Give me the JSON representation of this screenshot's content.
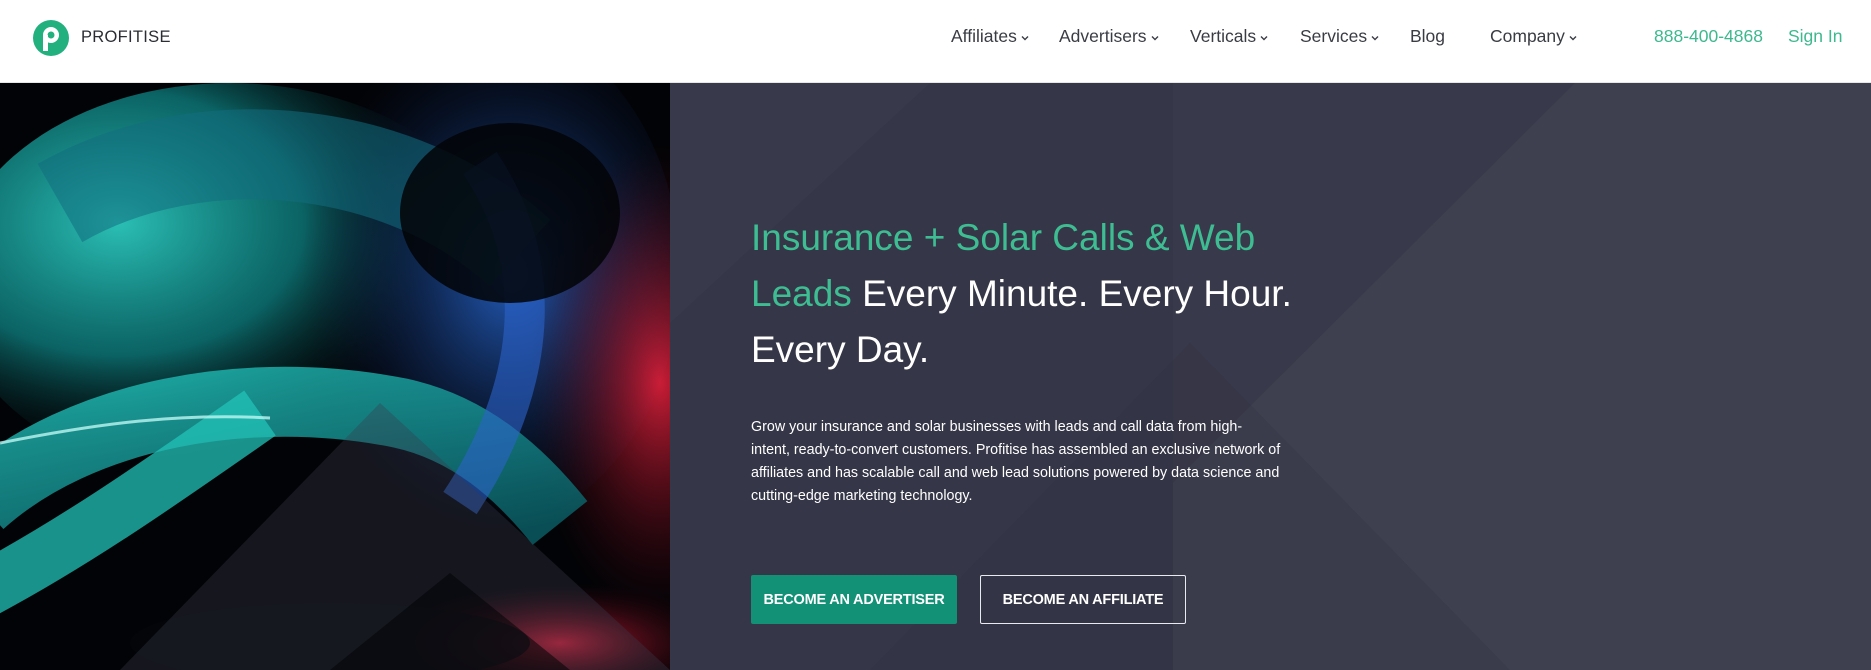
{
  "header": {
    "logo_text": "PROFITISE",
    "nav": [
      {
        "label": "Affiliates",
        "dropdown": true
      },
      {
        "label": "Advertisers",
        "dropdown": true
      },
      {
        "label": "Verticals",
        "dropdown": true
      },
      {
        "label": "Services",
        "dropdown": true
      },
      {
        "label": "Blog",
        "dropdown": false
      },
      {
        "label": "Company",
        "dropdown": true
      }
    ],
    "phone": "888-400-4868",
    "signin": "Sign In"
  },
  "hero": {
    "headline_accent": "Insurance + Solar Calls & Web Leads",
    "headline_rest": " Every Minute. Every Hour. Every Day.",
    "subtext": "Grow your insurance and solar businesses with leads and call data from high-intent, ready-to-convert customers. Profitise has assembled an exclusive network of affiliates and has scalable call and web lead solutions powered by data science and cutting-edge marketing technology.",
    "cta_primary": "BECOME AN ADVERTISER",
    "cta_secondary": "BECOME AN AFFILIATE"
  },
  "colors": {
    "accent": "#3ebd92",
    "button": "#129177",
    "panel": "#353647"
  },
  "icons": {
    "logo": "profitise-logo-icon",
    "chevron": "chevron-down-icon"
  }
}
